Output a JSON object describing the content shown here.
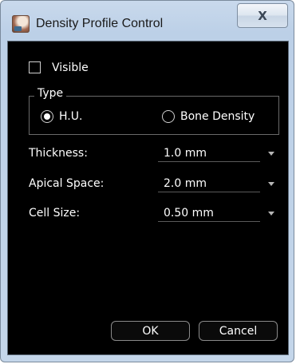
{
  "window": {
    "title": "Density Profile Control",
    "close_glyph": "X"
  },
  "visible_checkbox": {
    "label": "Visible",
    "checked": false
  },
  "type_group": {
    "label": "Type",
    "options": [
      {
        "label": "H.U.",
        "selected": true
      },
      {
        "label": "Bone Density",
        "selected": false
      }
    ]
  },
  "fields": [
    {
      "label": "Thickness:",
      "value": "1.0 mm"
    },
    {
      "label": "Apical Space:",
      "value": "2.0 mm"
    },
    {
      "label": "Cell Size:",
      "value": "0.50 mm"
    }
  ],
  "buttons": {
    "ok": "OK",
    "cancel": "Cancel"
  },
  "icons": {
    "app": "density-profile-app-icon",
    "close": "close-icon",
    "dropdown": "chevron-down-icon"
  },
  "colors": {
    "panel_background": "#000000",
    "text": "#ffffff",
    "titlebar": "#bcd0e7"
  }
}
